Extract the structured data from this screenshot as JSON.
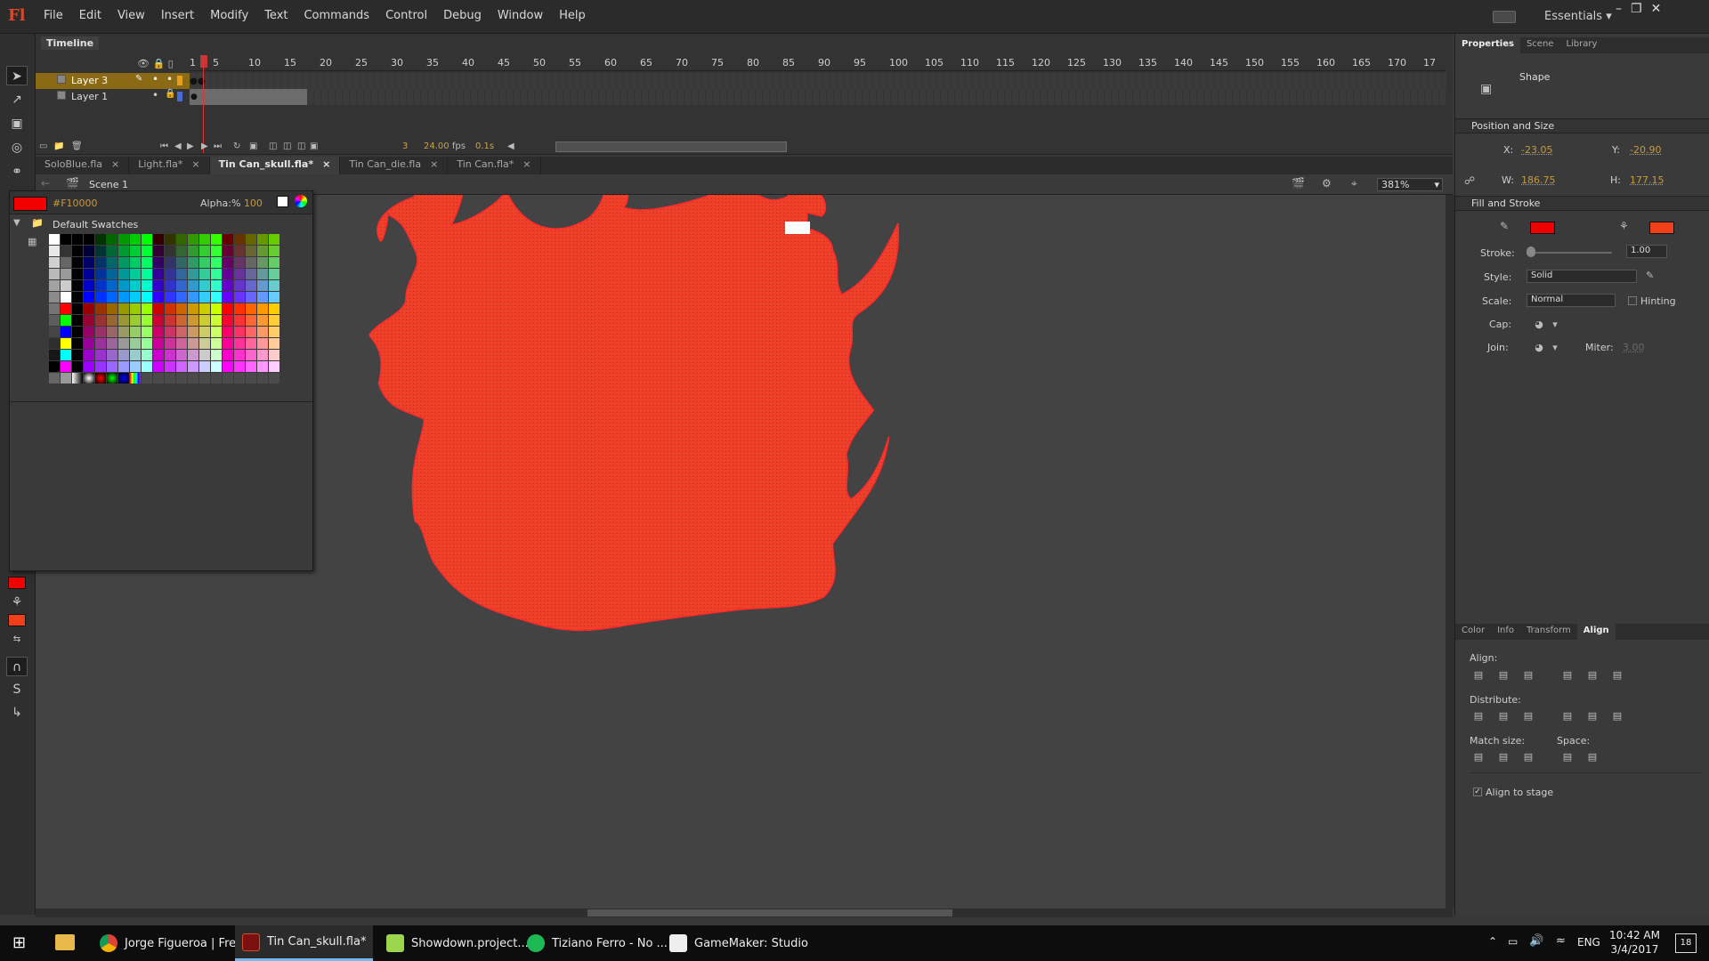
{
  "app": {
    "name": "Adobe Flash Professional",
    "logo_text": "Fl"
  },
  "menu": [
    "File",
    "Edit",
    "View",
    "Insert",
    "Modify",
    "Text",
    "Commands",
    "Control",
    "Debug",
    "Window",
    "Help"
  ],
  "workspace": "Essentials",
  "timeline": {
    "title": "Timeline",
    "ticks": [
      "1",
      "5",
      "10",
      "15",
      "20",
      "25",
      "30",
      "35",
      "40",
      "45",
      "50",
      "55",
      "60",
      "65",
      "70",
      "75",
      "80",
      "85",
      "90",
      "95",
      "100",
      "105",
      "110",
      "115",
      "120",
      "125",
      "130",
      "135",
      "140",
      "145",
      "150",
      "155",
      "160",
      "165",
      "170",
      "17"
    ],
    "layers": [
      {
        "name": "Layer 3",
        "selected": true,
        "color": "#e6a020"
      },
      {
        "name": "Layer 1",
        "selected": false,
        "color": "#4a6ad8"
      }
    ],
    "current_frame": "3",
    "fps": "24.00",
    "fps_unit": "fps",
    "time": "0.1s"
  },
  "doc_tabs": [
    {
      "label": "SoloBlue.fla",
      "active": false
    },
    {
      "label": "Light.fla*",
      "active": false
    },
    {
      "label": "Tin Can_skull.fla*",
      "active": true
    },
    {
      "label": "Tin Can_die.fla",
      "active": false
    },
    {
      "label": "Tin Can.fla*",
      "active": false
    }
  ],
  "scene": {
    "label": "Scene 1",
    "zoom": "381%"
  },
  "swatches": {
    "current_hex": "#F10000",
    "current_color": "#F10000",
    "alpha_label": "Alpha:%",
    "alpha_value": "100",
    "group_name": "Default Swatches"
  },
  "stage_shape": {
    "fill": "#f0402a",
    "stroke": "#ff2222"
  },
  "properties": {
    "tabs": [
      "Properties",
      "Scene",
      "Library"
    ],
    "object_type": "Shape",
    "position_size": {
      "header": "Position and Size",
      "x_label": "X:",
      "x": "-23.05",
      "y_label": "Y:",
      "y": "-20.90",
      "w_label": "W:",
      "w": "186.75",
      "h_label": "H:",
      "h": "177.15"
    },
    "fill_stroke": {
      "header": "Fill and Stroke",
      "stroke_color": "#F10000",
      "fill_color": "#f0401a",
      "stroke_label": "Stroke:",
      "stroke_value": "1.00",
      "style_label": "Style:",
      "style": "Solid",
      "scale_label": "Scale:",
      "scale": "Normal",
      "hinting_label": "Hinting",
      "cap_label": "Cap:",
      "join_label": "Join:",
      "miter_label": "Miter:",
      "miter_value": "3.00"
    }
  },
  "align_panel": {
    "tabs": [
      "Color",
      "Info",
      "Transform",
      "Align"
    ],
    "align_label": "Align:",
    "distribute_label": "Distribute:",
    "match_size_label": "Match size:",
    "space_label": "Space:",
    "align_to_stage_label": "Align to stage",
    "align_to_stage_checked": true
  },
  "taskbar": {
    "apps": [
      {
        "label": "Jorge Figueroa | Fre...",
        "icon": "chrome-icon",
        "active": false
      },
      {
        "label": "Tin Can_skull.fla*",
        "icon": "flash-icon",
        "active": true
      },
      {
        "label": "Showdown.project....",
        "icon": "gamemaker-icon",
        "active": false
      },
      {
        "label": "Tiziano Ferro - No ...",
        "icon": "spotify-icon",
        "active": false
      },
      {
        "label": "GameMaker: Studio",
        "icon": "gamemaker-studio-icon",
        "active": false
      }
    ],
    "lang": "ENG",
    "time": "10:42 AM",
    "date": "3/4/2017",
    "notifications": "18"
  }
}
